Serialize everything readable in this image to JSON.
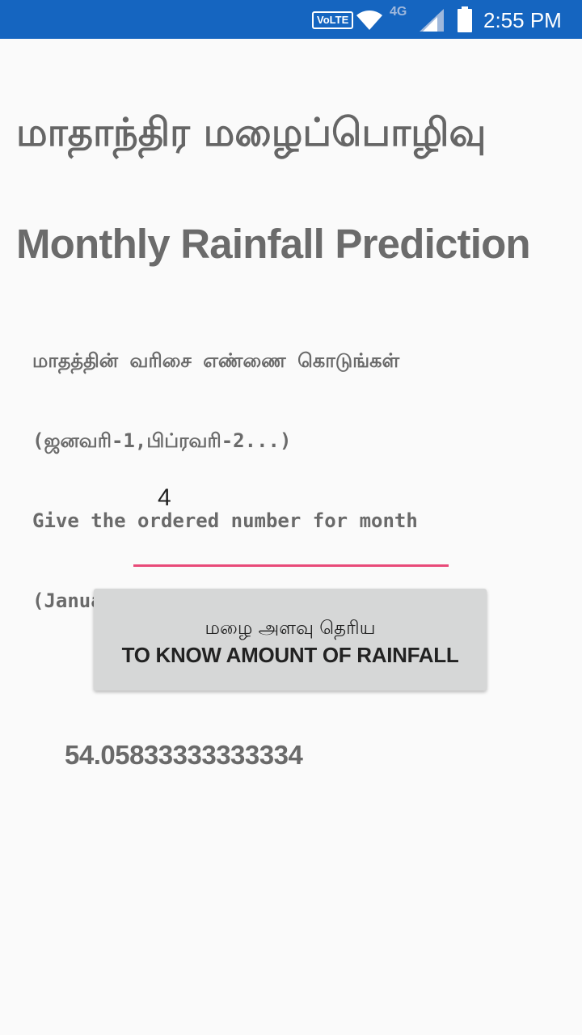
{
  "status_bar": {
    "volte": "VoLTE",
    "network": "4G",
    "time": "2:55 PM",
    "icons": [
      "wifi-icon",
      "signal-icon",
      "battery-icon"
    ],
    "background_color": "#1565c0"
  },
  "title": {
    "tamil": "மாதாந்திர மழைப்பொழிவு",
    "english": "Monthly Rainfall Prediction"
  },
  "instruction": {
    "tamil_line": "மாதத்தின் வரிசை எண்ணை கொடுங்கள்",
    "tamil_example": "(ஜனவரி-1,பிப்ரவரி-2...)",
    "english_line": "Give the ordered number for month",
    "english_example": "(January-1,February-2...)"
  },
  "month_input": {
    "value": "4",
    "underline_color": "#e84a78"
  },
  "button": {
    "tamil_label": "மழை அளவு தெரிய",
    "english_label": "TO KNOW AMOUNT OF RAINFALL"
  },
  "result": "54.05833333333334"
}
